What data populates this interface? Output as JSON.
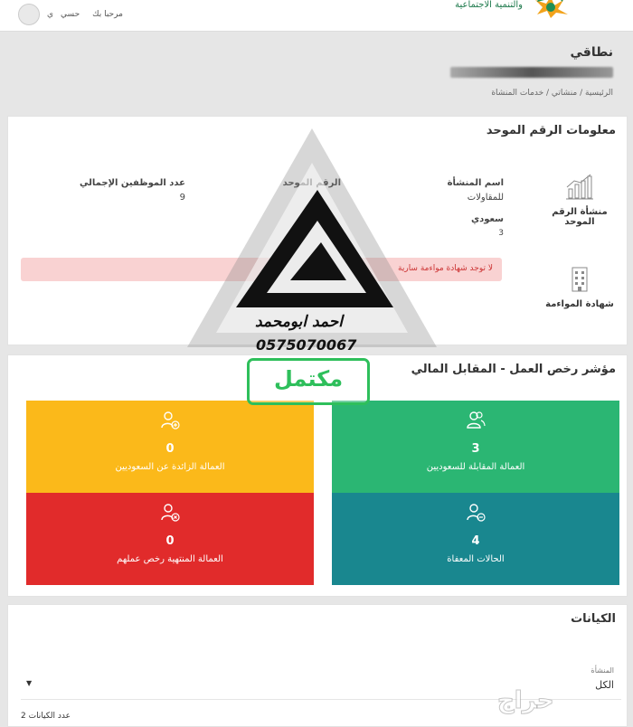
{
  "topbar": {
    "ministry_text": "والتنمية الاجتماعية",
    "user_name": "حسي",
    "greeting": "مرحبا بك",
    "user_suffix": "ي"
  },
  "header": {
    "title": "نطاقي",
    "breadcrumb": "الرئيسية / منشاتي / خدمات المنشاة"
  },
  "unified_number": {
    "title": "معلومات الرقم الموحد",
    "sidebar": [
      {
        "label": "منشأة الرقم الموحد",
        "icon": "bar-chart-icon"
      },
      {
        "label": "شهادة المواءمة",
        "icon": "building-icon"
      }
    ],
    "establishment_name_label": "اسم المنشأة",
    "establishment_name_value": "للمقاولات",
    "nationality": "سعودي",
    "nationality_count": "3",
    "unified_number_label": "الرقم الموحد",
    "total_employees_label": "عدد الموظفين الإجمالي",
    "total_employees_value": "9",
    "alert": "لا توجد شهادة مواءمة سارية"
  },
  "work_permits": {
    "title": "مؤشر رخص العمل - المقابل المالي",
    "tiles": [
      {
        "count": "3",
        "label": "العمالة المقابلة للسعوديين",
        "color": "#2bb673",
        "icon": "users-icon"
      },
      {
        "count": "0",
        "label": "العمالة الزائدة عن السعوديين",
        "color": "#fbb91a",
        "icon": "user-plus-icon"
      },
      {
        "count": "4",
        "label": "الحالات المعفاة",
        "color": "#19878f",
        "icon": "user-minus-icon"
      },
      {
        "count": "0",
        "label": "العمالة المنتهية رخص عملهم",
        "color": "#e12b2b",
        "icon": "user-x-icon"
      }
    ]
  },
  "entities": {
    "title": "الكيانات",
    "filter_label": "المنشأة",
    "filter_value": "الكل",
    "count_label": "عدد الكيانات 2"
  },
  "watermark": {
    "name": "احمد ابومحمد",
    "phone": "0575070067",
    "stamp": "مكتمل",
    "site": "حراج"
  }
}
